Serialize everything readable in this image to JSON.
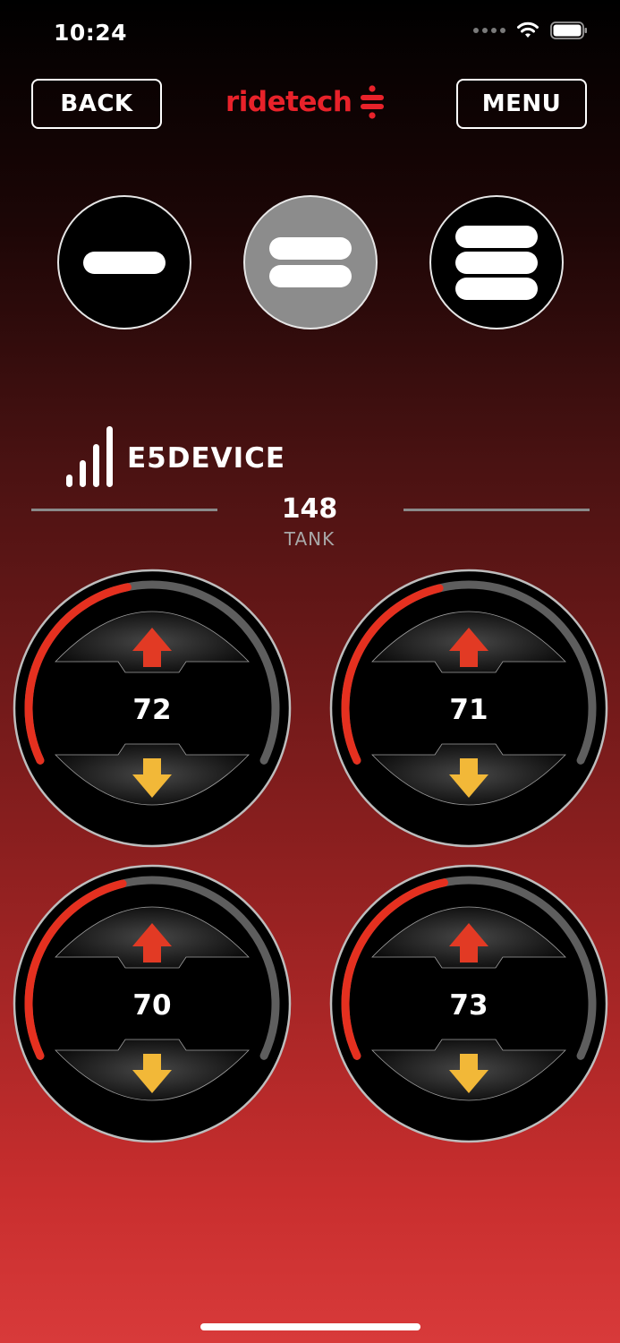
{
  "status_bar": {
    "time": "10:24"
  },
  "header": {
    "back_label": "BACK",
    "menu_label": "MENU",
    "logo_text": "ridetech",
    "logo_color": "#e8222a"
  },
  "presets": [
    {
      "bars": 1,
      "active": false
    },
    {
      "bars": 2,
      "active": true
    },
    {
      "bars": 3,
      "active": false
    }
  ],
  "device": {
    "name": "E5DEVICE",
    "signal_bars": 4
  },
  "tank": {
    "value": "148",
    "label": "TANK"
  },
  "gauges": [
    {
      "position": "front-left",
      "value": "72",
      "level_fraction": 0.45
    },
    {
      "position": "front-right",
      "value": "71",
      "level_fraction": 0.44
    },
    {
      "position": "rear-left",
      "value": "70",
      "level_fraction": 0.44
    },
    {
      "position": "rear-right",
      "value": "73",
      "level_fraction": 0.45
    }
  ],
  "colors": {
    "gauge_fill": "#e5301f",
    "gauge_track": "#5e5e5e",
    "arrow_up": "#e23a24",
    "arrow_down": "#f2b838"
  }
}
